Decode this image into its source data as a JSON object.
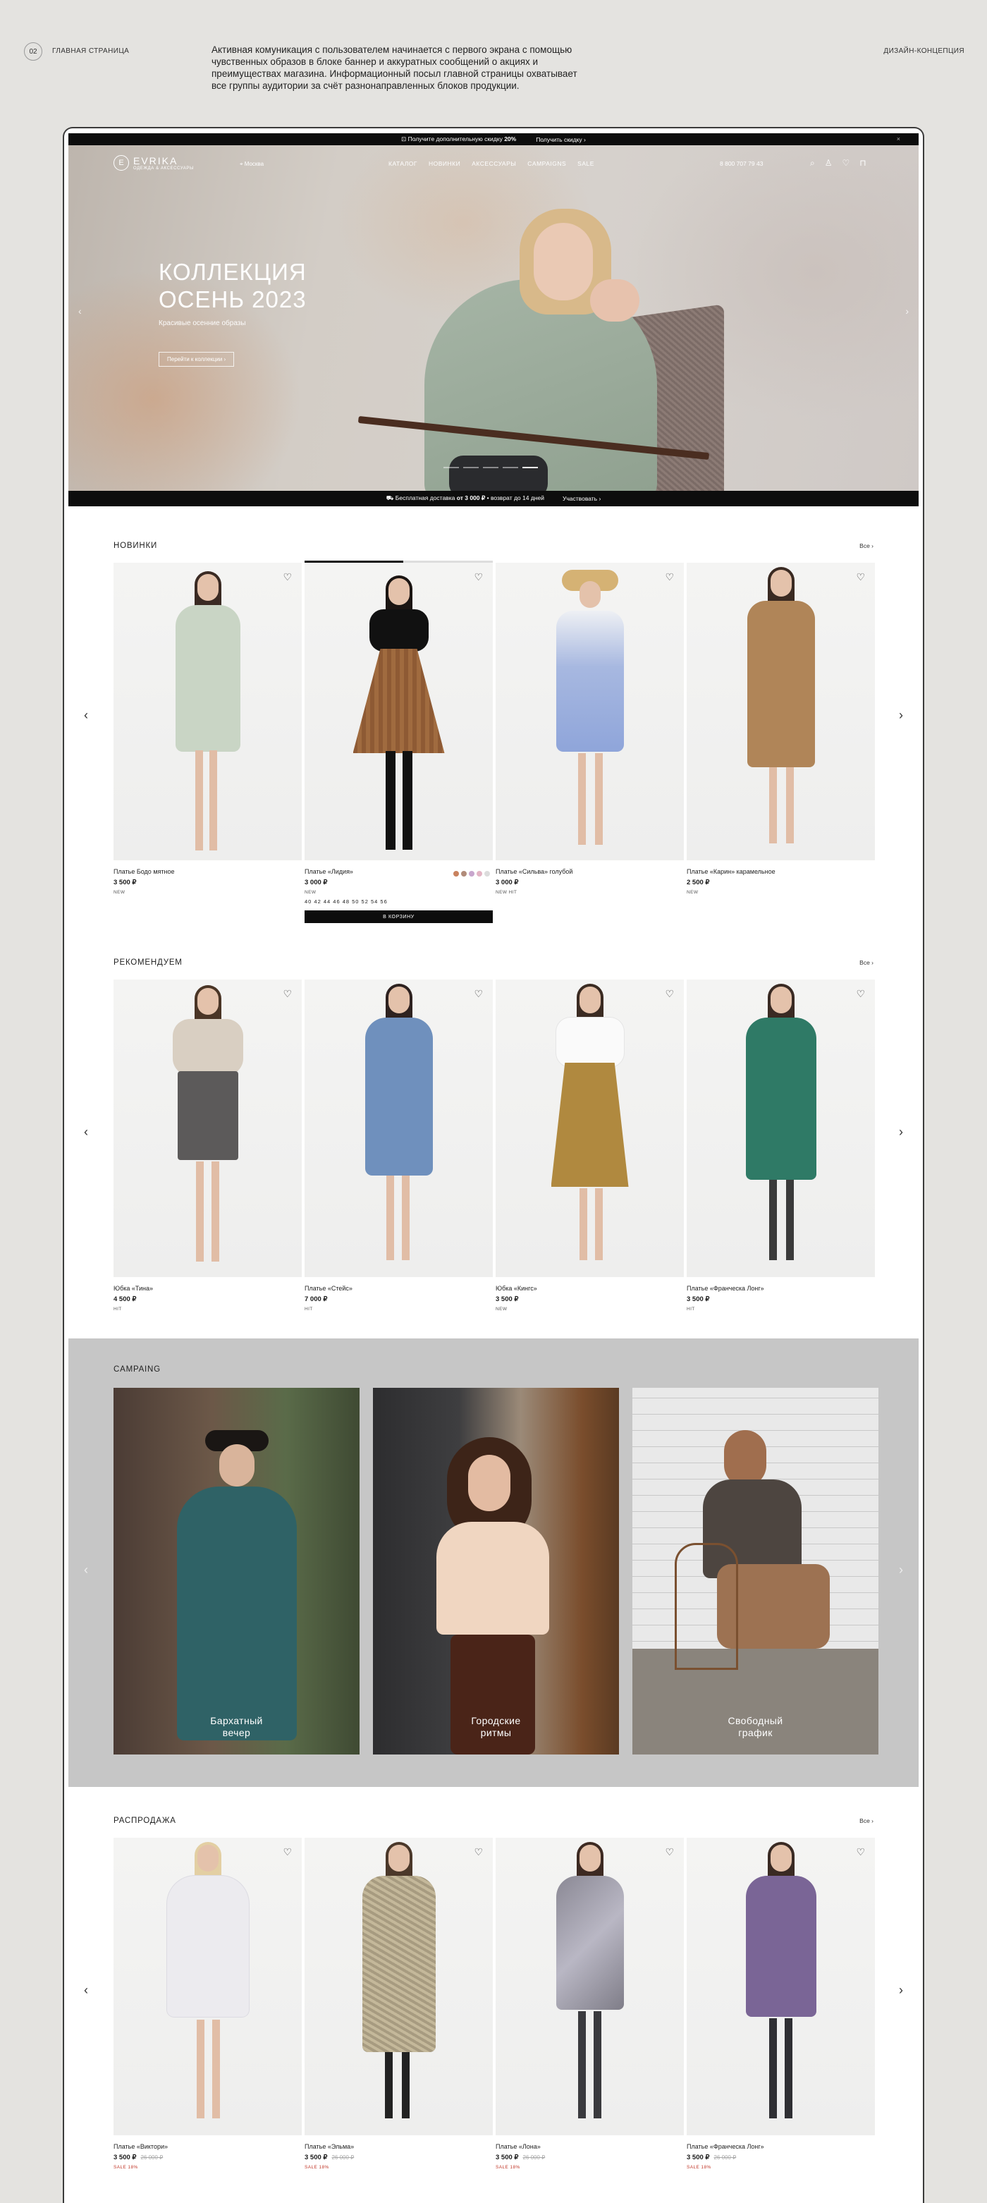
{
  "presentation": {
    "number": "02",
    "section": "ГЛАВНАЯ СТРАНИЦА",
    "description": "Активная комуникация с пользователем начинается с первого экрана с помощью чувственных образов в блоке баннер и аккуратных сообщений о акциях и преимуществах магазина. Информационный посыл главной страницы охватывает все группы аудитории за счёт разнонаправленных блоков продукции.",
    "right_label": "ДИЗАЙН-КОНЦЕПЦИЯ"
  },
  "promo": {
    "text_before": "Получите дополнительную скидку",
    "discount": "20%",
    "link": "Получить скидку ›",
    "close": "×"
  },
  "nav": {
    "logo_mark": "E",
    "logo_name": "EVRIKA",
    "logo_sub": "ОДЕЖДА & АКСЕССУАРЫ",
    "city": "⌖ Москва",
    "menu": [
      "КАТАЛОГ",
      "НОВИНКИ",
      "АКСЕССУАРЫ",
      "CAMPAIGNS",
      "SALE"
    ],
    "phone": "8 800 707 79 43",
    "icons": [
      "search-icon",
      "user-icon",
      "heart-icon",
      "bag-icon"
    ]
  },
  "hero": {
    "title_line1": "КОЛЛЕКЦИЯ",
    "title_line2": "ОСЕНЬ 2023",
    "subtitle": "Красивые осенние образы",
    "button": "Перейти к коллекции  ›",
    "arrow_left": "‹",
    "arrow_right": "›",
    "slides": 5,
    "active_slide": 5
  },
  "shipping": {
    "text_before": "Бесплатная доставка",
    "amount": "от 3 000 ₽",
    "text_after": "• возврат до 14 дней",
    "link": "Участвовать ›"
  },
  "novelties": {
    "title": "НОВИНКИ",
    "all": "Все ›",
    "items": [
      {
        "name": "Платье Бодо мятное",
        "price": "3 500 ₽",
        "tag": "NEW"
      },
      {
        "name": "Платье «Лидия»",
        "price": "3 000 ₽",
        "tag": "NEW",
        "sizes": "40 42 44 46 48 50 52 54 56",
        "button": "В КОРЗИНУ"
      },
      {
        "name": "Платье «Сильва» голубой",
        "price": "3 000 ₽",
        "tag": "NEW   HIT"
      },
      {
        "name": "Платье «Карин» карамельное",
        "price": "2 500 ₽",
        "tag": "NEW"
      }
    ],
    "swatches": [
      "#c9825f",
      "#b18c7a",
      "#c8a6cd",
      "#e3b4c4",
      "#dcdcdc"
    ]
  },
  "recommended": {
    "title": "РЕКОМЕНДУЕМ",
    "all": "Все ›",
    "items": [
      {
        "name": "Юбка «Тина»",
        "price": "4 500 ₽",
        "tag": "HIT"
      },
      {
        "name": "Платье «Стейс»",
        "price": "7 000 ₽",
        "tag": "HIT"
      },
      {
        "name": "Юбка «Кингс»",
        "price": "3 500 ₽",
        "tag": "NEW"
      },
      {
        "name": "Платье «Франческа Лонг»",
        "price": "3 500 ₽",
        "tag": "HIT"
      }
    ]
  },
  "campaign": {
    "title": "CAMPAING",
    "items": [
      {
        "line1": "Бархатный",
        "line2": "вечер"
      },
      {
        "line1": "Городские",
        "line2": "ритмы"
      },
      {
        "line1": "Свободный",
        "line2": "график"
      }
    ]
  },
  "sale": {
    "title": "РАСПРОДАЖА",
    "all": "Все ›",
    "items": [
      {
        "name": "Платье «Виктори»",
        "price": "3 500 ₽",
        "old": "26 000 ₽",
        "tag": "SALE 18%"
      },
      {
        "name": "Платье «Эльма»",
        "price": "3 500 ₽",
        "old": "26 000 ₽",
        "tag": "SALE 18%"
      },
      {
        "name": "Платье «Лона»",
        "price": "3 500 ₽",
        "old": "26 000 ₽",
        "tag": "SALE 18%"
      },
      {
        "name": "Платье «Франческа Лонг»",
        "price": "3 500 ₽",
        "old": "26 000 ₽",
        "tag": "SALE 18%"
      }
    ]
  }
}
